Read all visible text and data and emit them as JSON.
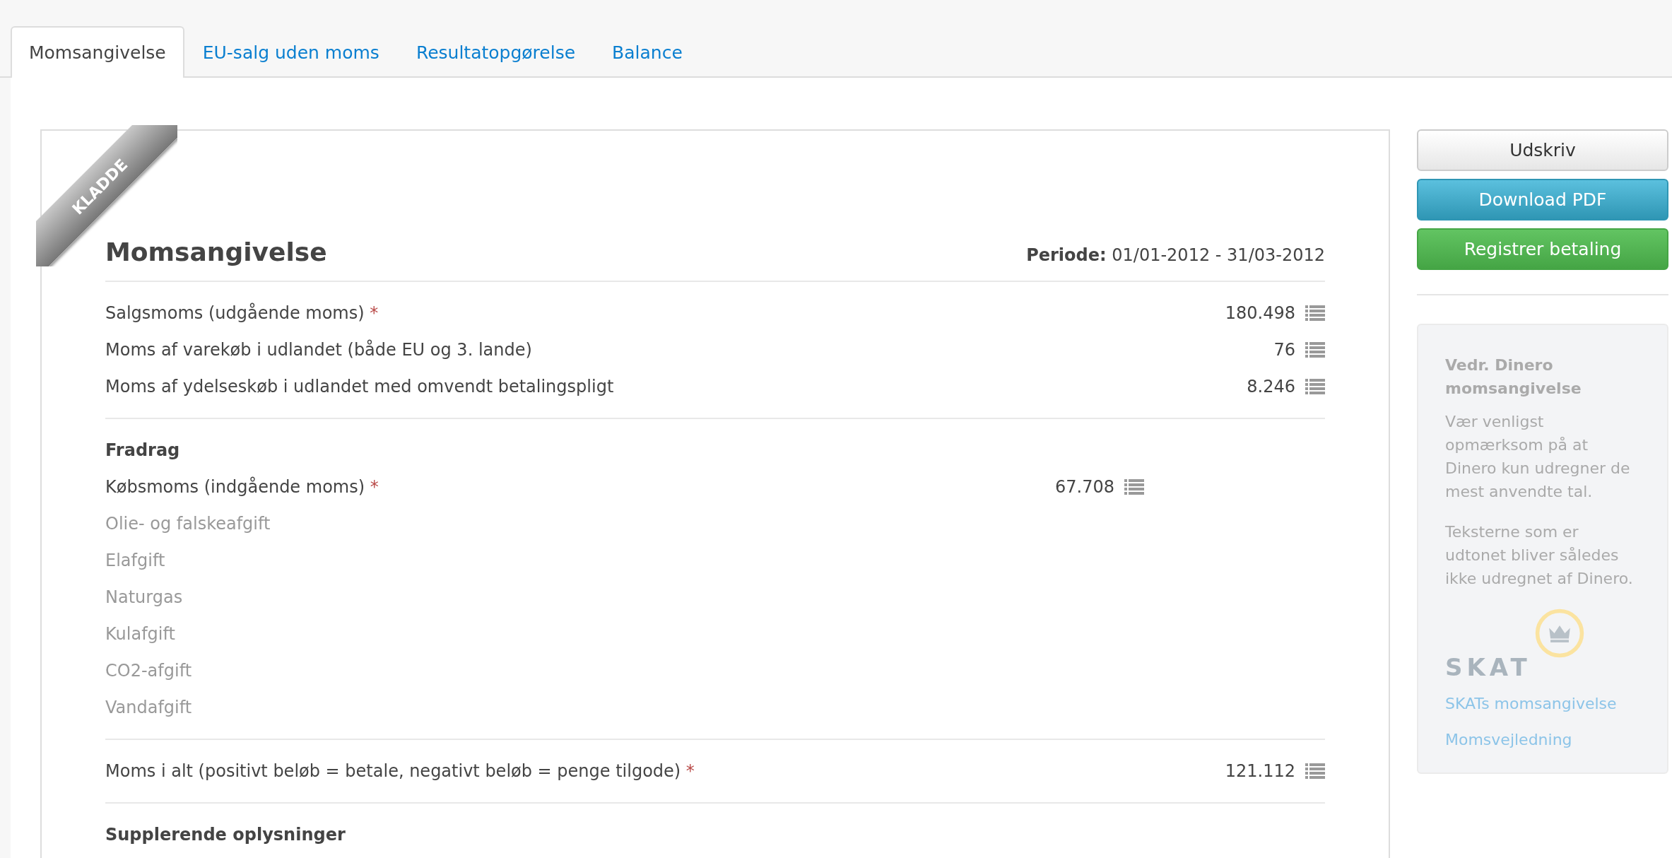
{
  "tabs": [
    {
      "label": "Momsangivelse",
      "selected": true
    },
    {
      "label": "EU-salg uden moms",
      "selected": false
    },
    {
      "label": "Resultatopgørelse",
      "selected": false
    },
    {
      "label": "Balance",
      "selected": false
    }
  ],
  "ribbon": {
    "label": "KLADDE"
  },
  "report": {
    "title": "Momsangivelse",
    "period_label": "Periode:",
    "period_value": "01/01-2012 - 31/03-2012",
    "sections": [
      {
        "rows": [
          {
            "kind": "main",
            "label": "Salgsmoms (udgående moms)",
            "required_mark": "*",
            "disabled": false,
            "value": "180.498"
          },
          {
            "kind": "main",
            "label": "Moms af varekøb i udlandet (både EU og 3. lande)",
            "disabled": false,
            "value": "76"
          },
          {
            "kind": "main",
            "label": "Moms af ydelseskøb i udlandet med omvendt betalingspligt",
            "disabled": false,
            "value": "8.246"
          }
        ]
      },
      {
        "heading": "Fradrag",
        "rows": [
          {
            "kind": "sub",
            "label": "Købsmoms (indgående moms)",
            "required_mark": "*",
            "disabled": false,
            "value": "67.708"
          },
          {
            "kind": "sub",
            "label": "Olie- og falskeafgift",
            "disabled": true
          },
          {
            "kind": "sub",
            "label": "Elafgift",
            "disabled": true
          },
          {
            "kind": "sub",
            "label": "Naturgas",
            "disabled": true
          },
          {
            "kind": "sub",
            "label": "Kulafgift",
            "disabled": true
          },
          {
            "kind": "sub",
            "label": "CO2-afgift",
            "disabled": true
          },
          {
            "kind": "sub",
            "label": "Vandafgift",
            "disabled": true
          }
        ]
      },
      {
        "rows": [
          {
            "kind": "main",
            "label": "Moms i alt (positivt beløb = betale, negativt beløb = penge tilgode)",
            "required_mark": "*",
            "disabled": false,
            "value": "121.112"
          }
        ]
      },
      {
        "heading": "Supplerende oplysninger"
      }
    ]
  },
  "actions": [
    {
      "kind": "default",
      "label": "Udskriv"
    },
    {
      "kind": "info",
      "label": "Download PDF"
    },
    {
      "kind": "success",
      "label": "Registrer betaling"
    }
  ],
  "info": {
    "title": "Vedr. Dinero momsangivelse",
    "paragraphs": [
      "Vær venligst opmærksom på at Dinero kun udregner de mest anvendte tal.",
      "Teksterne som er udtonet bliver således ikke udregnet af Dinero."
    ],
    "logo_text": "SKAT",
    "links": [
      "SKATs momsangivelse",
      "Momsvejledning"
    ]
  }
}
